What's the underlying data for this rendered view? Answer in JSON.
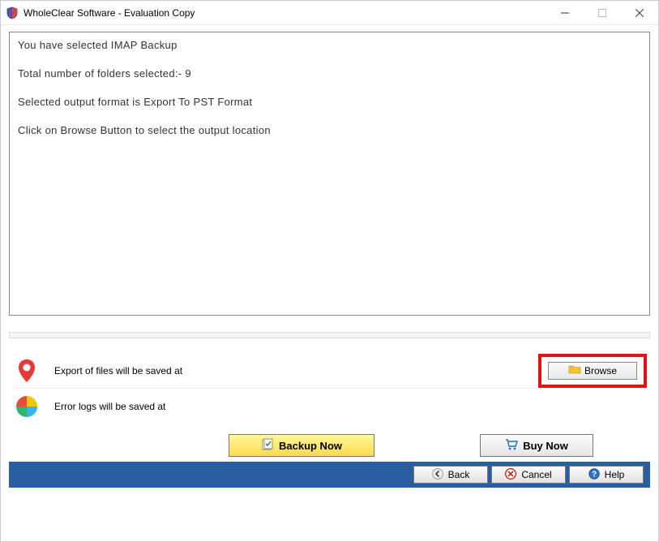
{
  "title": "WholeClear Software - Evaluation Copy",
  "info": {
    "line1": "You have selected IMAP Backup",
    "line2": "Total number of folders selected:- 9",
    "line3": "Selected output format is Export To PST Format",
    "line4": "Click on Browse Button to select the output location"
  },
  "exportRow": {
    "label": "Export of files will be saved at",
    "browse": "Browse"
  },
  "logRow": {
    "label": "Error logs will be saved at"
  },
  "buttons": {
    "backup": "Backup Now",
    "buy": "Buy Now"
  },
  "bottom": {
    "back": "Back",
    "cancel": "Cancel",
    "help": "Help"
  }
}
